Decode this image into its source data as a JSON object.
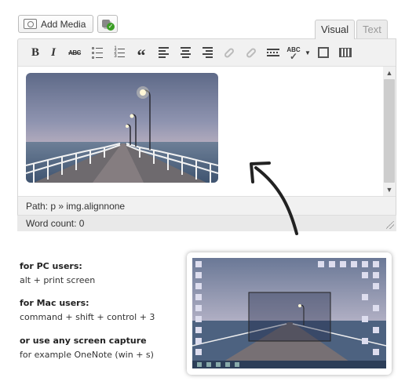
{
  "media": {
    "add_media_label": "Add Media"
  },
  "tabs": {
    "visual": "Visual",
    "text": "Text"
  },
  "toolbar": {
    "bold": "B",
    "italic": "I",
    "strike": "ABC",
    "quote": "“",
    "spellcheck": "ABC"
  },
  "status": {
    "path": "Path: p » img.alignnone",
    "word_count": "Word count: 0"
  },
  "instructions": {
    "pc_heading": "for PC users:",
    "pc_text": "alt + print screen",
    "mac_heading": "for Mac users:",
    "mac_text": "command + shift + control + 3",
    "any_heading": "or use any screen capture",
    "any_text": "for example OneNote (win + s)"
  },
  "colors": {
    "accent_green": "#3a9d23",
    "arrow": "#222222"
  }
}
